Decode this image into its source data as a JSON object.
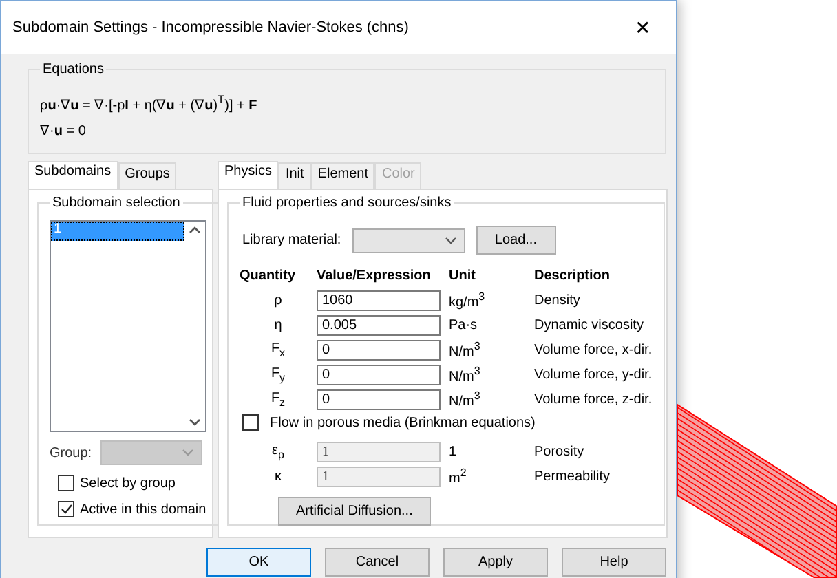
{
  "window": {
    "title": "Subdomain Settings - Incompressible Navier-Stokes (chns)",
    "close": "✕"
  },
  "equations": {
    "title": "Equations",
    "lines": [
      "ρ**u**·∇**u** = ∇·[-p**I** + η(∇**u** + (∇**u**)$^{T}$)] + **F**",
      "∇·**u** = 0"
    ]
  },
  "left_tabs": [
    {
      "label": "Subdomains",
      "selected": true
    },
    {
      "label": "Groups",
      "selected": false
    }
  ],
  "subdomain_selection": {
    "title": "Subdomain selection",
    "items": [
      {
        "label": "1",
        "selected": true
      }
    ]
  },
  "group": {
    "label": "Group:",
    "disabled": true
  },
  "checkboxes": [
    {
      "label": "Select by group",
      "checked": false
    },
    {
      "label": "Active in this domain",
      "checked": true
    }
  ],
  "right_tabs": [
    {
      "label": "Physics",
      "selected": true,
      "disabled": false
    },
    {
      "label": "Init",
      "selected": false,
      "disabled": false
    },
    {
      "label": "Element",
      "selected": false,
      "disabled": false
    },
    {
      "label": "Color",
      "selected": false,
      "disabled": true
    }
  ],
  "fluid": {
    "title": "Fluid properties and sources/sinks",
    "library_label": "Library material:",
    "load_button": "Load...",
    "columns": [
      "Quantity",
      "Value/Expression",
      "Unit",
      "Description"
    ],
    "rows": [
      {
        "quantity": "ρ",
        "value": "1060",
        "unit": "kg/m$^{3}$",
        "description": "Density",
        "disabled": false
      },
      {
        "quantity": "η",
        "value": "0.005",
        "unit": "Pa·s",
        "description": "Dynamic viscosity",
        "disabled": false
      },
      {
        "quantity": "F$_{x}$",
        "value": "0",
        "unit": "N/m$^{3}$",
        "description": "Volume force, x-dir.",
        "disabled": false
      },
      {
        "quantity": "F$_{y}$",
        "value": "0",
        "unit": "N/m$^{3}$",
        "description": "Volume force, y-dir.",
        "disabled": false
      },
      {
        "quantity": "F$_{z}$",
        "value": "0",
        "unit": "N/m$^{3}$",
        "description": "Volume force, z-dir.",
        "disabled": false
      }
    ],
    "porous": {
      "label": "Flow in porous media (Brinkman equations)",
      "checked": false
    },
    "porous_rows": [
      {
        "quantity": "ε$_{p}$",
        "value": "1",
        "unit": "1",
        "description": "Porosity",
        "disabled": true
      },
      {
        "quantity": "κ",
        "value": "1",
        "unit": "m$^{2}$",
        "description": "Permeability",
        "disabled": true
      }
    ],
    "diffusion_button": "Artificial Diffusion..."
  },
  "buttons": [
    {
      "label": "OK",
      "kind": "default"
    },
    {
      "label": "Cancel",
      "kind": "normal"
    },
    {
      "label": "Apply",
      "kind": "normal"
    },
    {
      "label": "Help",
      "kind": "normal"
    }
  ]
}
